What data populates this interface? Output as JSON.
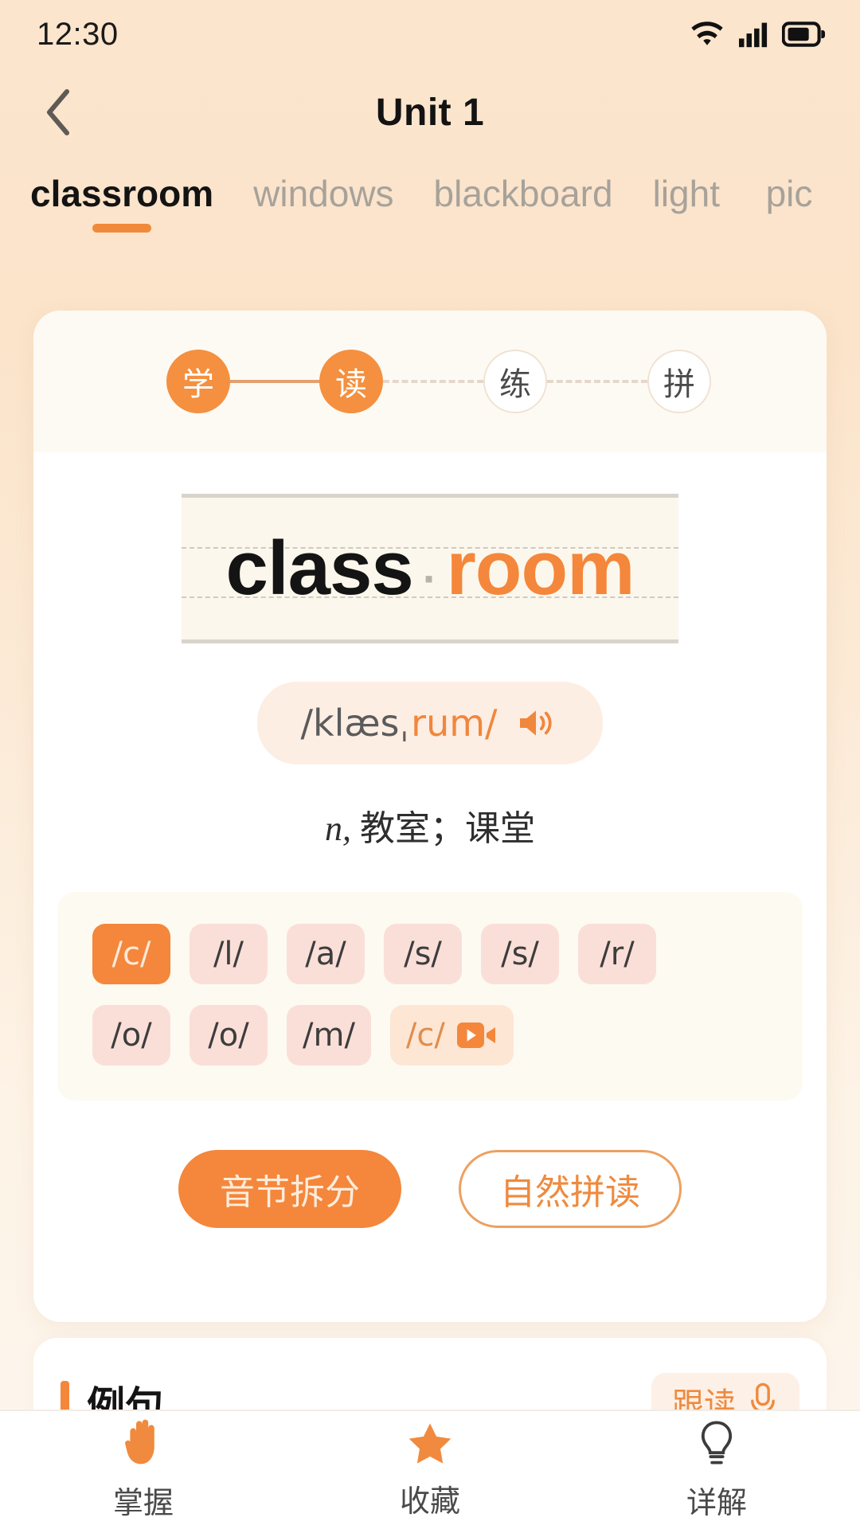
{
  "status_bar": {
    "time": "12:30",
    "icons": [
      "wifi-icon",
      "signal-icon",
      "battery-icon"
    ]
  },
  "nav": {
    "back_icon": "chevron-left-icon",
    "title": "Unit 1"
  },
  "tabs": {
    "items": [
      {
        "label": "classroom",
        "active": true
      },
      {
        "label": "windows",
        "active": false
      },
      {
        "label": "blackboard",
        "active": false
      },
      {
        "label": "light",
        "active": false
      },
      {
        "label": "pic",
        "active": false
      }
    ]
  },
  "steps": [
    {
      "label": "学",
      "state": "done"
    },
    {
      "label": "读",
      "state": "done"
    },
    {
      "label": "练",
      "state": "todo"
    },
    {
      "label": "拼",
      "state": "todo"
    }
  ],
  "word": {
    "syllable_1": "class",
    "separator": "·",
    "syllable_2": "room"
  },
  "phonetic": {
    "part_1": "/klæsˌ",
    "part_2": "rum/",
    "speaker_icon": "speaker-icon"
  },
  "definition": {
    "pos": "n,",
    "meaning": "教室；课堂"
  },
  "phonics": {
    "row_1": [
      {
        "label": "/c/",
        "active": true
      },
      {
        "label": "/l/",
        "active": false
      },
      {
        "label": "/a/",
        "active": false
      },
      {
        "label": "/s/",
        "active": false
      },
      {
        "label": "/s/",
        "active": false
      },
      {
        "label": "/r/",
        "active": false
      }
    ],
    "row_2": [
      {
        "label": "/o/",
        "active": false,
        "video": false
      },
      {
        "label": "/o/",
        "active": false,
        "video": false
      },
      {
        "label": "/m/",
        "active": false,
        "video": false
      },
      {
        "label": "/c/",
        "active": false,
        "video": true,
        "video_icon": "video-camera-icon"
      }
    ]
  },
  "actions": {
    "primary_label": "音节拆分",
    "ghost_label": "自然拼读"
  },
  "example_section": {
    "title": "例句",
    "follow_label": "跟读",
    "follow_icon": "microphone-icon"
  },
  "bottom_nav": [
    {
      "label": "掌握",
      "icon": "hand-icon"
    },
    {
      "label": "收藏",
      "icon": "star-icon"
    },
    {
      "label": "详解",
      "icon": "lightbulb-icon"
    }
  ],
  "colors": {
    "accent": "#f4873b",
    "accent_light": "#fadfd8",
    "background_top": "#fbe5cd",
    "background_bottom": "#fdf6ee",
    "text_dark": "#141414",
    "text_muted": "#a7a29a"
  }
}
